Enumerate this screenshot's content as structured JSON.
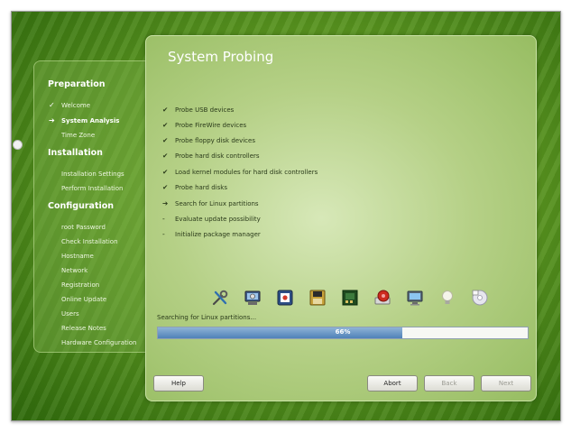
{
  "sidebar": {
    "sections": [
      {
        "title": "Preparation",
        "items": [
          {
            "label": "Welcome",
            "mark": "✓"
          },
          {
            "label": "System Analysis",
            "mark": "➔",
            "current": true
          },
          {
            "label": "Time Zone",
            "mark": ""
          }
        ]
      },
      {
        "title": "Installation",
        "items": [
          {
            "label": "Installation Settings",
            "mark": ""
          },
          {
            "label": "Perform Installation",
            "mark": ""
          }
        ]
      },
      {
        "title": "Configuration",
        "items": [
          {
            "label": "root Password",
            "mark": ""
          },
          {
            "label": "Check Installation",
            "mark": ""
          },
          {
            "label": "Hostname",
            "mark": ""
          },
          {
            "label": "Network",
            "mark": ""
          },
          {
            "label": "Registration",
            "mark": ""
          },
          {
            "label": "Online Update",
            "mark": ""
          },
          {
            "label": "Users",
            "mark": ""
          },
          {
            "label": "Release Notes",
            "mark": ""
          },
          {
            "label": "Hardware Configuration",
            "mark": ""
          }
        ]
      }
    ]
  },
  "main": {
    "title": "System Probing",
    "tasks": [
      {
        "mark": "✔",
        "label": "Probe USB devices"
      },
      {
        "mark": "✔",
        "label": "Probe FireWire devices"
      },
      {
        "mark": "✔",
        "label": "Probe floppy disk devices"
      },
      {
        "mark": "✔",
        "label": "Probe hard disk controllers"
      },
      {
        "mark": "✔",
        "label": "Load kernel modules for hard disk controllers"
      },
      {
        "mark": "✔",
        "label": "Probe hard disks"
      },
      {
        "mark": "➔",
        "label": "Search for Linux partitions"
      },
      {
        "mark": "-",
        "label": "Evaluate update possibility"
      },
      {
        "mark": "-",
        "label": "Initialize package manager"
      }
    ],
    "icons": [
      "tools-icon",
      "hardware-probe-icon",
      "usb-device-icon",
      "floppy-disk-icon",
      "hard-disk-controller-icon",
      "hard-disk-icon",
      "monitor-icon",
      "light-bulb-icon",
      "cd-disc-icon"
    ],
    "status_text": "Searching for Linux partitions...",
    "progress": {
      "label": "66%",
      "fraction": 0.66
    }
  },
  "buttons": {
    "help": "Help",
    "abort": "Abort",
    "back": "Back",
    "next": "Next"
  }
}
